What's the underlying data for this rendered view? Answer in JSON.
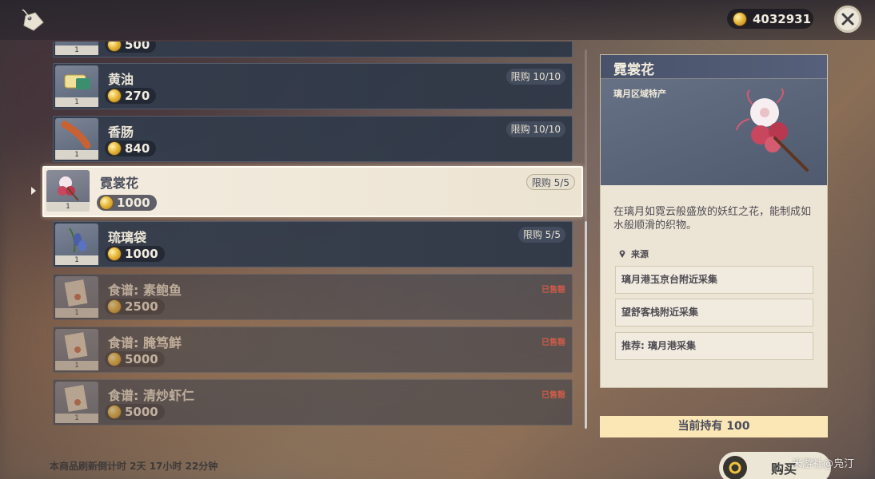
{
  "topbar": {
    "mora": "4032931"
  },
  "items": [
    {
      "name": "",
      "price": "500",
      "qty": "1",
      "limit": "",
      "sold_out": false
    },
    {
      "name": "黄油",
      "price": "270",
      "qty": "1",
      "limit": "限购 10/10",
      "sold_out": false
    },
    {
      "name": "香肠",
      "price": "840",
      "qty": "1",
      "limit": "限购 10/10",
      "sold_out": false
    },
    {
      "name": "霓裳花",
      "price": "1000",
      "qty": "1",
      "limit": "限购 5/5",
      "sold_out": false,
      "selected": true
    },
    {
      "name": "琉璃袋",
      "price": "1000",
      "qty": "1",
      "limit": "限购 5/5",
      "sold_out": false
    },
    {
      "name": "食谱: 素鲍鱼",
      "price": "2500",
      "qty": "1",
      "sold_label": "已售罄",
      "sold_out": true
    },
    {
      "name": "食谱: 腌笃鲜",
      "price": "5000",
      "qty": "1",
      "sold_label": "已售罄",
      "sold_out": true
    },
    {
      "name": "食谱: 清炒虾仁",
      "price": "5000",
      "qty": "1",
      "sold_label": "已售罄",
      "sold_out": true
    }
  ],
  "refresh_text": "本商品刷新倒计时 2天 17小时 22分钟",
  "detail": {
    "title": "霓裳花",
    "subtitle": "璃月区域特产",
    "description": "在璃月如霓云般盛放的妖红之花，能制成如水般顺滑的织物。",
    "source_title": "来源",
    "sources": [
      "璃月港玉京台附近采集",
      "望舒客栈附近采集",
      "推荐: 璃月港采集"
    ]
  },
  "holding": "当前持有 100",
  "buy_label": "购买",
  "watermark": "米游社@凫汀"
}
